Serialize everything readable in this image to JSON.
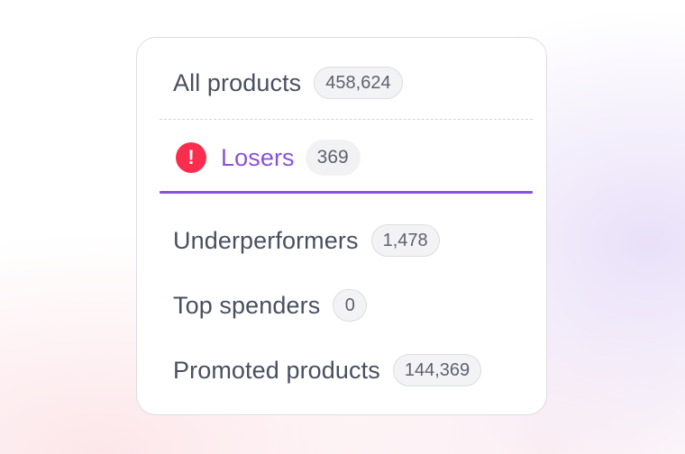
{
  "segments": {
    "all_products": {
      "label": "All products",
      "count": "458,624"
    },
    "losers": {
      "label": "Losers",
      "count": "369",
      "icon": "alert-icon",
      "color": "#8a52d8",
      "icon_color": "#fb2d4e",
      "selected": true
    },
    "underperformers": {
      "label": "Underperformers",
      "count": "1,478"
    },
    "top_spenders": {
      "label": "Top spenders",
      "count": "0"
    },
    "promoted_products": {
      "label": "Promoted products",
      "count": "144,369"
    }
  }
}
